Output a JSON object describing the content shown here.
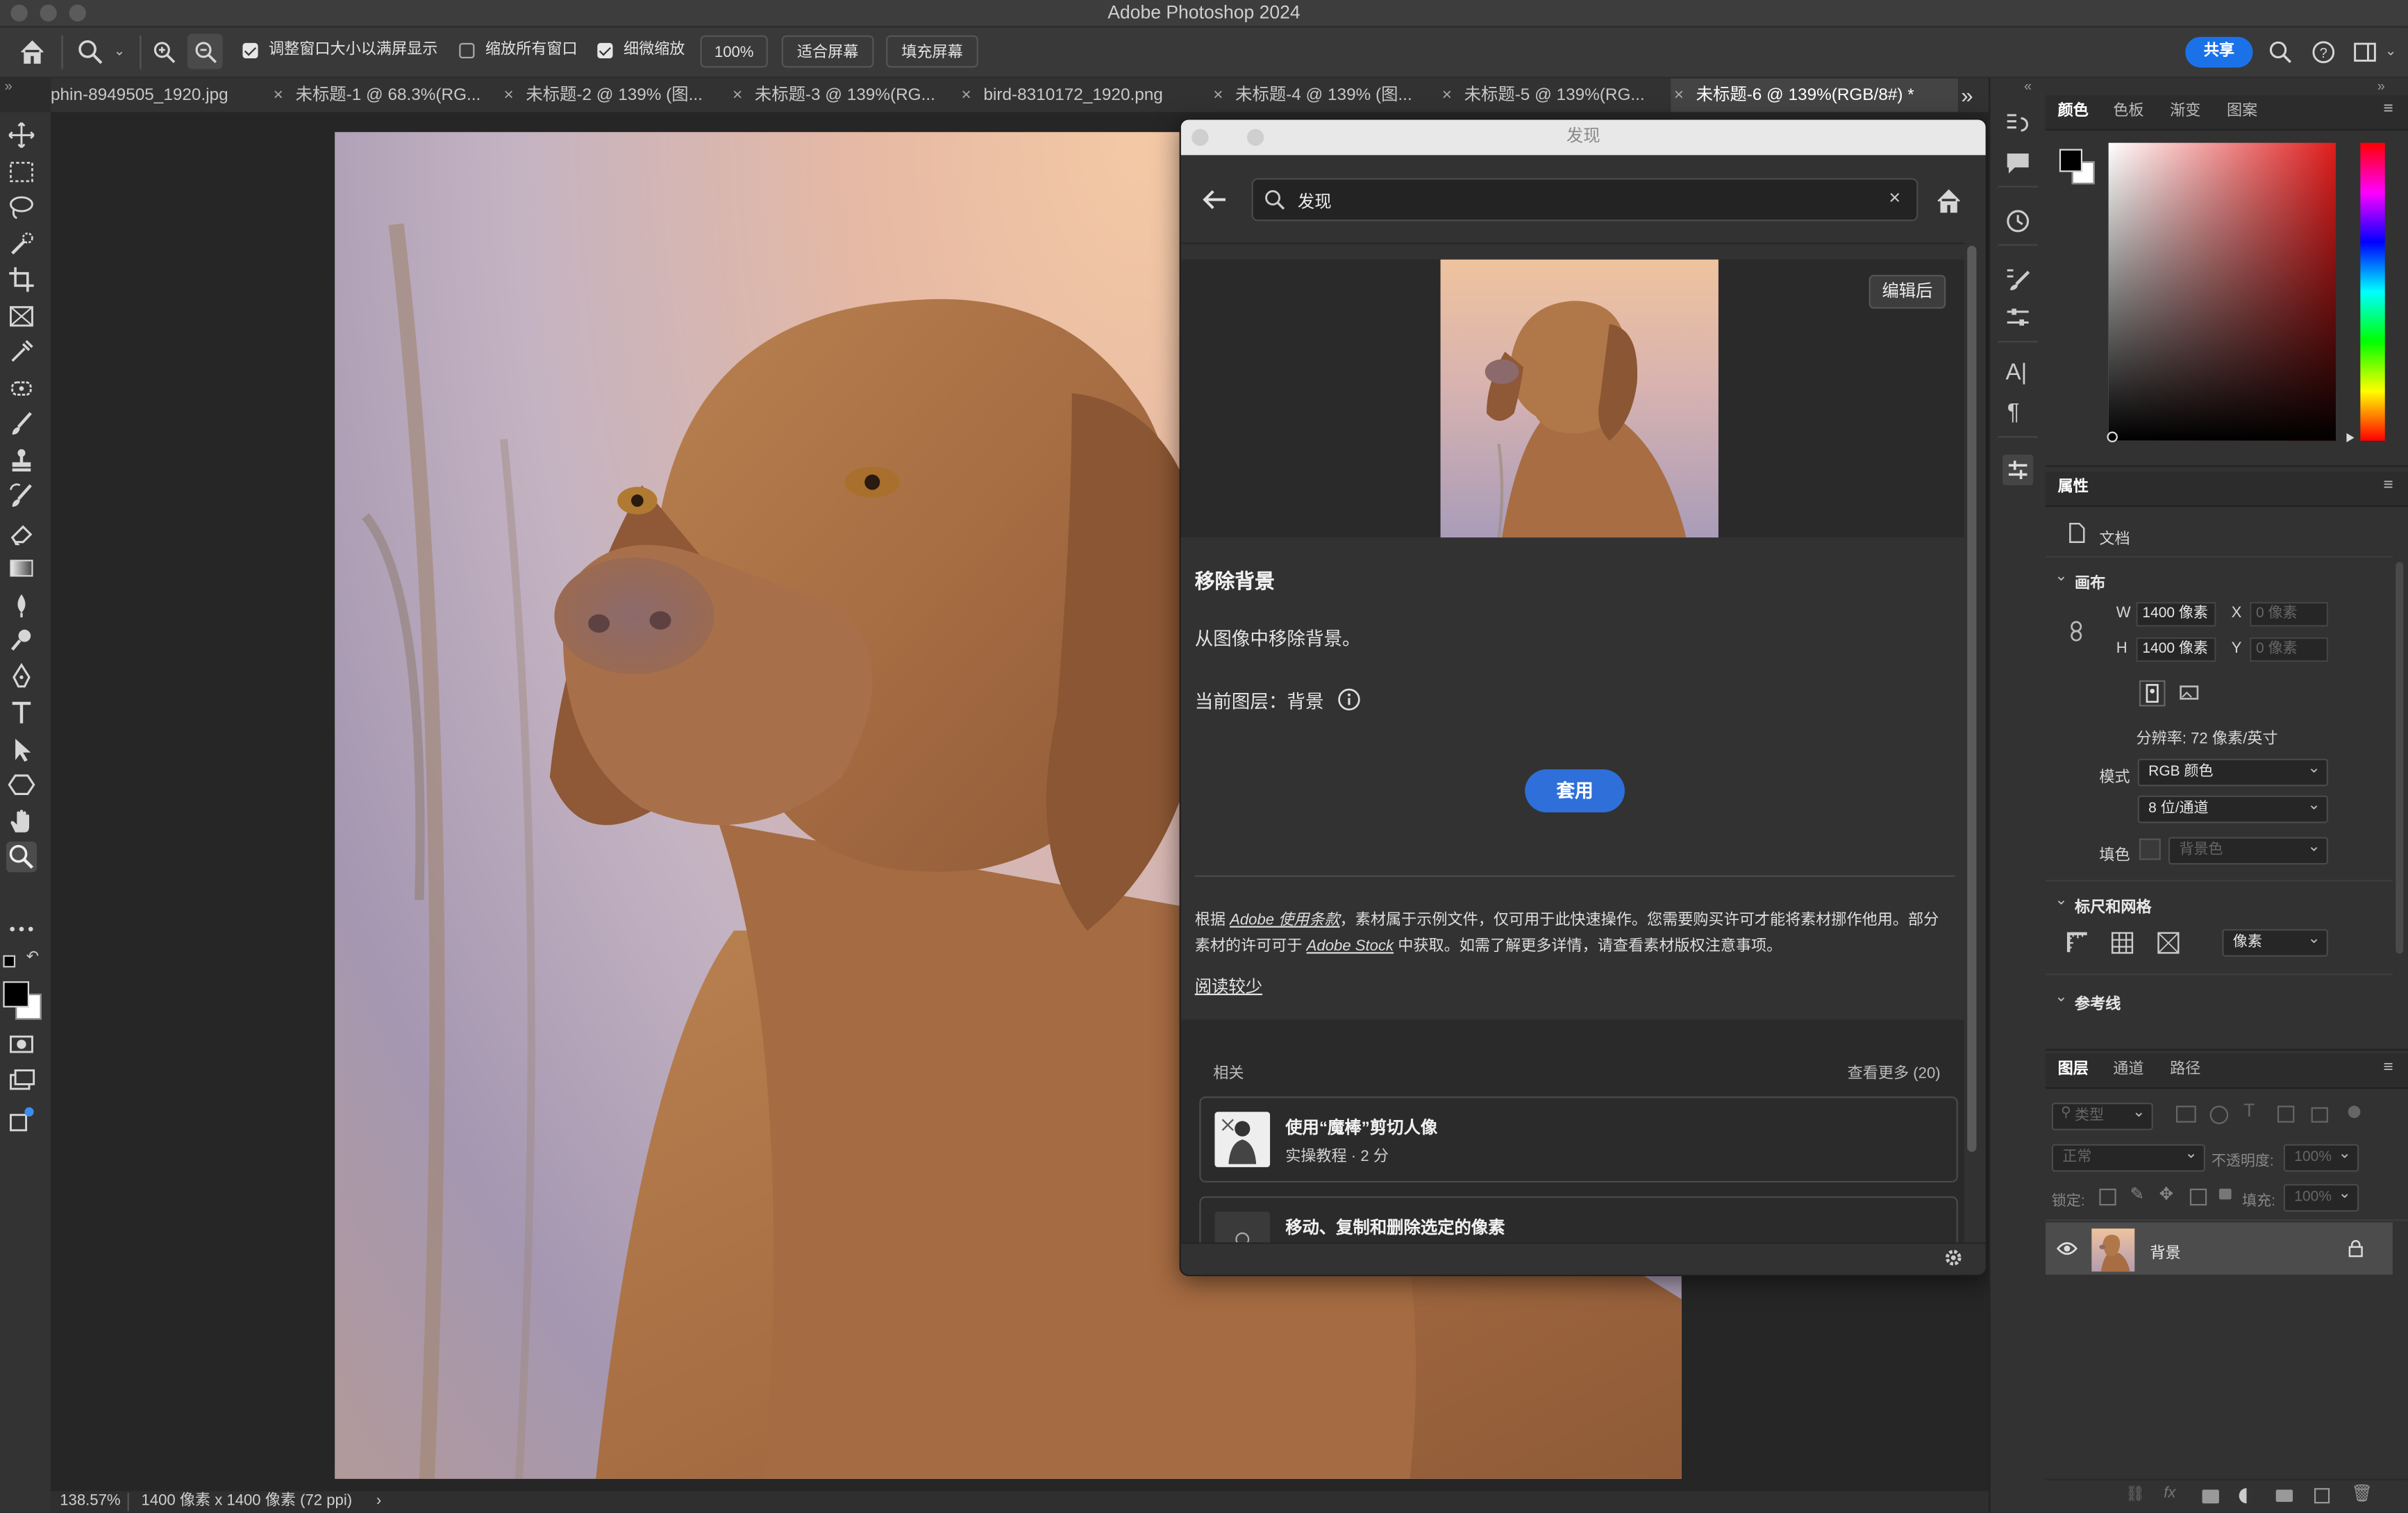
{
  "window": {
    "title": "Adobe Photoshop 2024"
  },
  "options": {
    "resize_windows_label": "调整窗口大小以满屏显示",
    "zoom_all_label": "缩放所有窗口",
    "scrubby_zoom_label": "细微缩放",
    "zoom_value": "100%",
    "fit_screen_label": "适合屏幕",
    "fill_screen_label": "填充屏幕",
    "resize_windows_checked": true,
    "zoom_all_checked": false,
    "scrubby_zoom_checked": true,
    "share_label": "共享"
  },
  "tabs": [
    {
      "label": "phin-8949505_1920.jpg"
    },
    {
      "label": "未标题-1 @ 68.3%(RG..."
    },
    {
      "label": "未标题-2 @ 139% (图..."
    },
    {
      "label": "未标题-3 @ 139%(RG..."
    },
    {
      "label": "bird-8310172_1920.png"
    },
    {
      "label": "未标题-4 @ 139% (图..."
    },
    {
      "label": "未标题-5 @ 139%(RG..."
    },
    {
      "label": "未标题-6 @ 139%(RGB/8#) *"
    }
  ],
  "tabs_overflow": "»",
  "status": {
    "zoom": "138.57%",
    "doc_info": "1400 像素 x 1400 像素 (72 ppi)",
    "arrow": "›"
  },
  "discover": {
    "title": "发现",
    "search_value": "发现",
    "edited_label": "编辑后",
    "heading": "移除背景",
    "description": "从图像中移除背景。",
    "current_layer_label": "当前图层：背景",
    "apply_label": "套用",
    "legal_p1": "根据 ",
    "legal_link1": "Adobe 使用条款",
    "legal_p2": "，素材属于示例文件，仅可用于此快速操作。您需要购买许可才能将素材挪作他用。部分素材的许可可于 ",
    "legal_link2": "Adobe Stock",
    "legal_p3": " 中获取。如需了解更多详情，请查看素材版权注意事项。",
    "read_less": "阅读较少",
    "related_label": "相关",
    "see_more": "查看更多 (20)",
    "related": [
      {
        "title": "使用“魔棒”剪切人像",
        "meta": "实操教程 · 2 分"
      },
      {
        "title": "移动、复制和删除选定的像素",
        "meta": ""
      }
    ]
  },
  "color_panel": {
    "tabs": [
      "颜色",
      "色板",
      "渐变",
      "图案"
    ]
  },
  "properties": {
    "tab": "属性",
    "doc_label": "文档",
    "canvas_label": "画布",
    "w_label": "W",
    "w_value": "1400 像素",
    "h_label": "H",
    "h_value": "1400 像素",
    "x_label": "X",
    "x_value": "0 像素",
    "y_label": "Y",
    "y_value": "0 像素",
    "resolution": "分辨率: 72 像素/英寸",
    "mode_label": "模式",
    "mode_value": "RGB 颜色",
    "depth_value": "8 位/通道",
    "fill_label": "填色",
    "fill_value": "背景色",
    "rulers_label": "标尺和网格",
    "units_value": "像素",
    "guides_label": "参考线"
  },
  "layers_panel": {
    "tabs": [
      "图层",
      "通道",
      "路径"
    ],
    "filter_kind": "类型",
    "blend_mode": "正常",
    "opacity_label": "不透明度:",
    "opacity_value": "100%",
    "lock_label": "锁定:",
    "fill_label": "填充:",
    "fill_value": "100%",
    "layers": [
      {
        "name": "背景",
        "visible": true,
        "locked": true
      }
    ]
  },
  "colors": {
    "accent": "#1b72e8",
    "apply_button": "#2e6fd9",
    "foreground": "#000000",
    "background": "#ffffff"
  }
}
